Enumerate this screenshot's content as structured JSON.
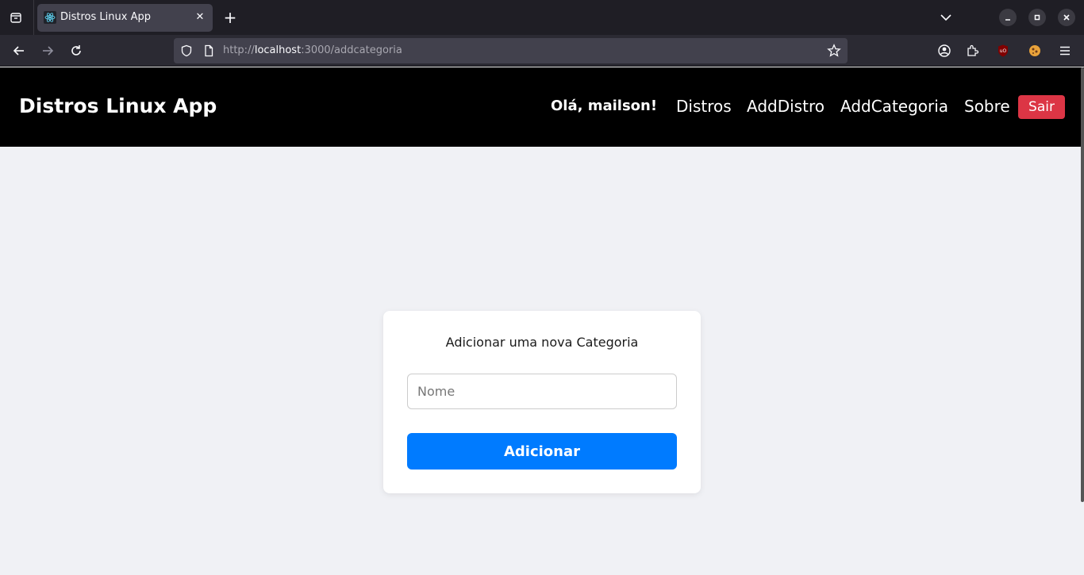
{
  "browser": {
    "tab_title": "Distros Linux App",
    "url_prefix": "http://",
    "url_host": "localhost",
    "url_path": ":3000/addcategoria"
  },
  "header": {
    "brand": "Distros Linux App",
    "greeting": "Olá, mailson!",
    "links": [
      "Distros",
      "AddDistro",
      "AddCategoria",
      "Sobre"
    ],
    "logout_label": "Sair"
  },
  "form": {
    "title": "Adicionar uma nova Categoria",
    "name_placeholder": "Nome",
    "name_value": "",
    "submit_label": "Adicionar"
  },
  "colors": {
    "header_bg": "#000000",
    "logout_bg": "#dc3545",
    "submit_bg": "#007bff",
    "page_bg": "#f0f1f5"
  }
}
